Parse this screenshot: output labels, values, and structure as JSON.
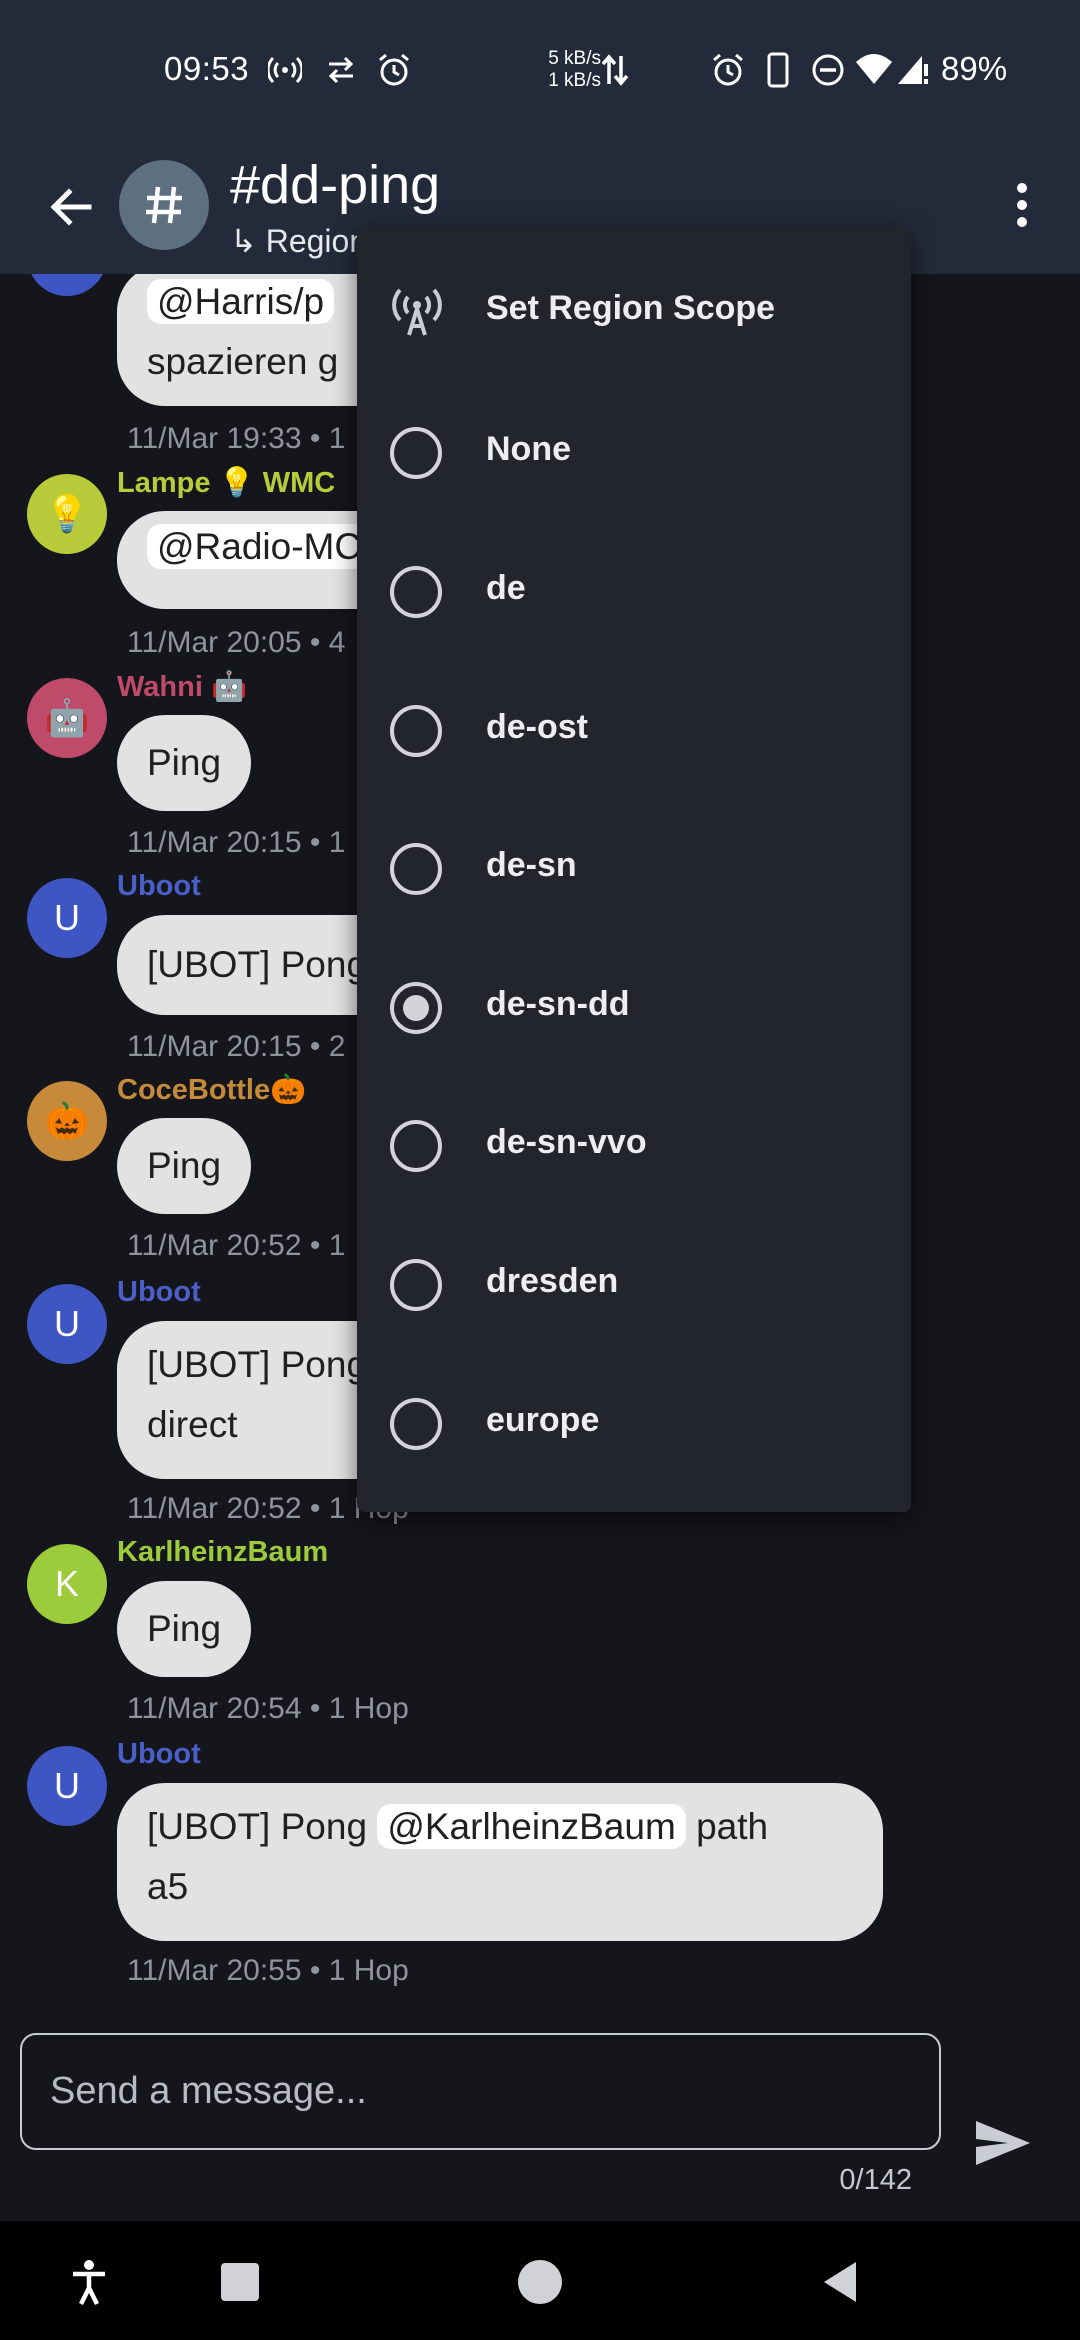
{
  "status_bar": {
    "time": "09:53",
    "net_speed_up": "5 kB/s",
    "net_speed_down": "1 kB/s",
    "battery": "89%",
    "icons": [
      "hotspot-icon",
      "sync-icon",
      "alarm-icon",
      "data-arrows-icon",
      "alarm-icon",
      "phone-icon",
      "dnd-icon",
      "wifi-icon",
      "signal-icon"
    ]
  },
  "header": {
    "channel_name": "#dd-ping",
    "subtitle": "↳ Region",
    "channel_avatar_icon": "hash-icon"
  },
  "messages": [
    {
      "sender": "",
      "sender_color": "#4a5fc7",
      "text_pre": "",
      "mention": "@Harris/p",
      "text_post": "",
      "line2": "spazieren g",
      "meta": "11/Mar 19:33 • 1"
    },
    {
      "sender": "Lampe 💡 WMC",
      "sender_color": "#b8cc3b",
      "avatar": "💡",
      "avatar_color": "#b8cc3b",
      "mention": "@Radio-MC",
      "meta": "11/Mar 20:05 • 4"
    },
    {
      "sender": "Wahni 🤖",
      "sender_color": "#c04a6a",
      "avatar": "🤖",
      "avatar_color": "#c04a6a",
      "text": "Ping",
      "meta": "11/Mar 20:15 • 1"
    },
    {
      "sender": "Uboot",
      "sender_color": "#4a5fc7",
      "avatar": "U",
      "avatar_color": "#3e55c4",
      "text": "[UBOT] Pong",
      "meta": "11/Mar 20:15 • 2"
    },
    {
      "sender": "CoceBottle🎃",
      "sender_color": "#c68a3a",
      "avatar": "🎃",
      "avatar_color": "#c68a3a",
      "text": "Ping",
      "meta": "11/Mar 20:52 • 1"
    },
    {
      "sender": "Uboot",
      "sender_color": "#4a5fc7",
      "avatar": "U",
      "avatar_color": "#3e55c4",
      "text": "[UBOT] Pong",
      "line2": "direct",
      "meta": "11/Mar 20:52 • 1 Hop"
    },
    {
      "sender": "KarlheinzBaum",
      "sender_color": "#9ccc3b",
      "avatar": "K",
      "avatar_color": "#9ccc3b",
      "text": "Ping",
      "meta": "11/Mar 20:54 • 1 Hop"
    },
    {
      "sender": "Uboot",
      "sender_color": "#4a5fc7",
      "avatar": "U",
      "avatar_color": "#3e55c4",
      "text_pre": "[UBOT] Pong",
      "mention": "@KarlheinzBaum",
      "text_post": "path",
      "line2": "a5",
      "meta": "11/Mar 20:55 • 1 Hop"
    }
  ],
  "region_menu": {
    "title": "Set Region Scope",
    "title_icon": "radio-tower-icon",
    "options": [
      "None",
      "de",
      "de-ost",
      "de-sn",
      "de-sn-dd",
      "de-sn-vvo",
      "dresden",
      "europe"
    ],
    "selected": "de-sn-dd"
  },
  "composer": {
    "placeholder": "Send a message...",
    "counter": "0/142",
    "send_icon": "send-icon"
  },
  "nav_bar": {
    "icons": [
      "accessibility-icon",
      "recents-icon",
      "home-icon",
      "back-icon"
    ]
  }
}
